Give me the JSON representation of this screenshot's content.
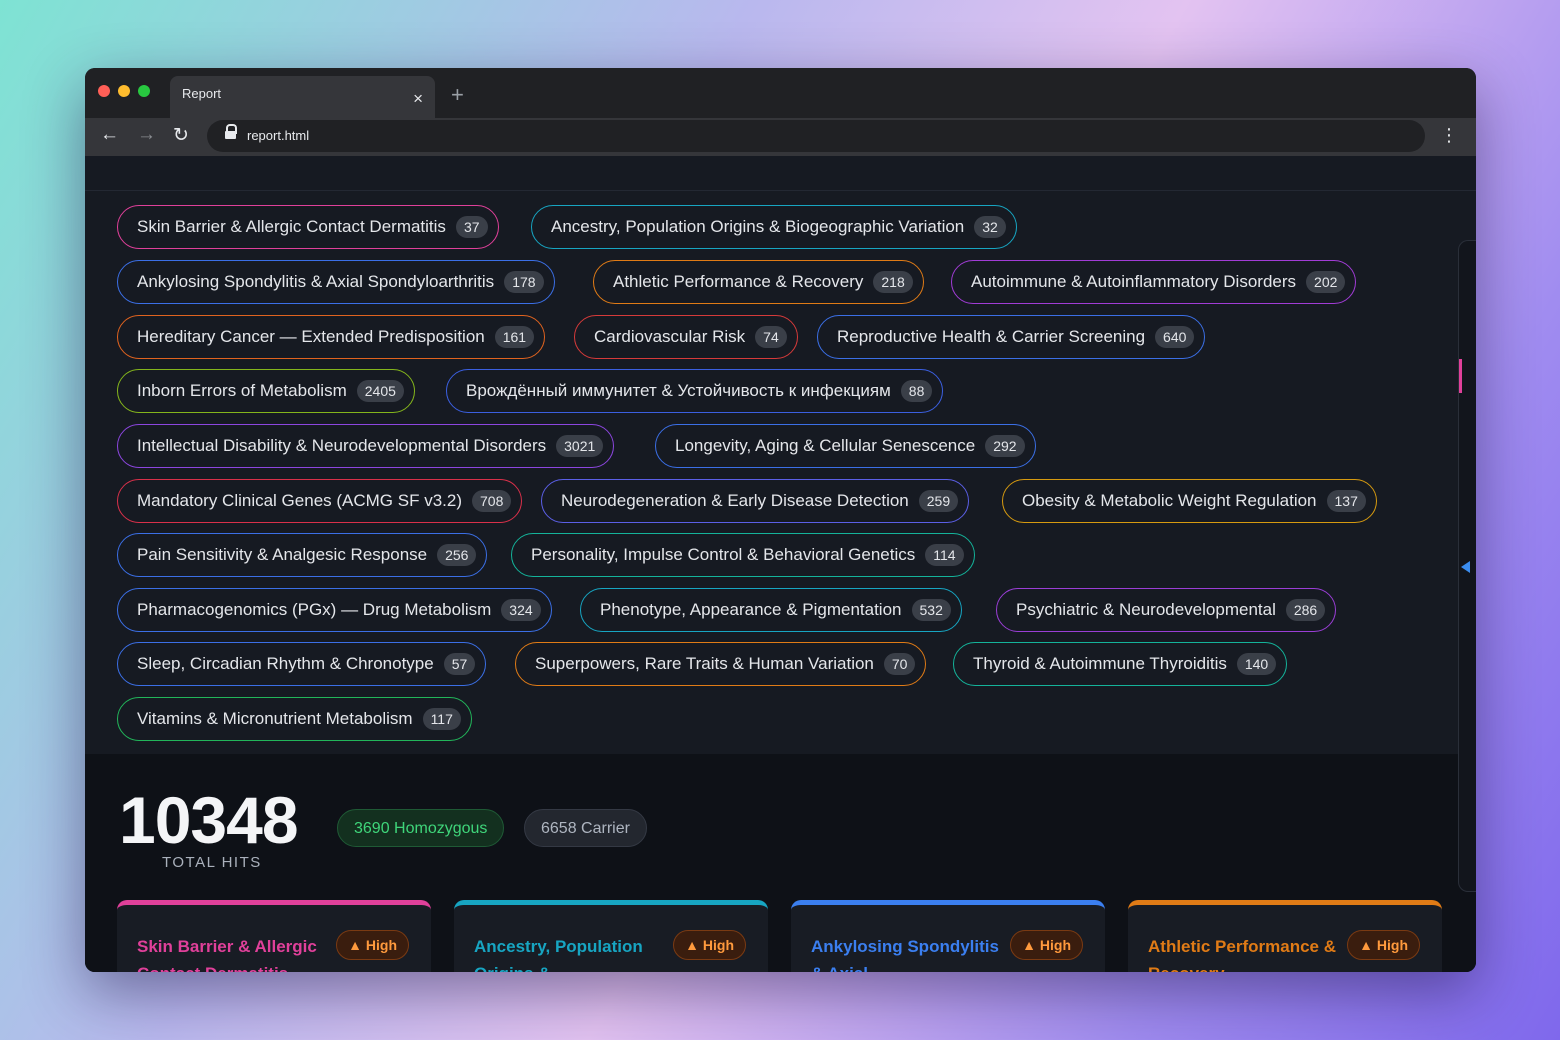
{
  "browser": {
    "tab_title": "Report",
    "tab_close": "×",
    "new_tab": "+",
    "url": "report.html",
    "back": "←",
    "forward": "→",
    "reload": "↻",
    "menu": "⋮"
  },
  "categories": [
    {
      "label": "Skin Barrier & Allergic Contact Dermatitis",
      "count": "37",
      "color": "#e0409a"
    },
    {
      "label": "Ancestry, Population Origins & Biogeographic Variation",
      "count": "32",
      "color": "#17a5c2"
    },
    {
      "label": "Ankylosing Spondylitis & Axial Spondyloarthritis",
      "count": "178",
      "color": "#3b6fe6"
    },
    {
      "label": "Athletic Performance & Recovery",
      "count": "218",
      "color": "#e07b16"
    },
    {
      "label": "Autoimmune & Autoinflammatory Disorders",
      "count": "202",
      "color": "#a13cd6"
    },
    {
      "label": "Hereditary Cancer — Extended Predisposition",
      "count": "161",
      "color": "#e0631f"
    },
    {
      "label": "Cardiovascular Risk",
      "count": "74",
      "color": "#d63a3a"
    },
    {
      "label": "Reproductive Health & Carrier Screening",
      "count": "640",
      "color": "#3b6fe6"
    },
    {
      "label": "Inborn Errors of Metabolism",
      "count": "2405",
      "color": "#84b51c"
    },
    {
      "label": "Врождённый иммунитет & Устойчивость к инфекциям",
      "count": "88",
      "color": "#3b5fe0"
    },
    {
      "label": "Intellectual Disability & Neurodevelopmental Disorders",
      "count": "3021",
      "color": "#8c46e0"
    },
    {
      "label": "Longevity, Aging & Cellular Senescence",
      "count": "292",
      "color": "#3b6fe6"
    },
    {
      "label": "Mandatory Clinical Genes (ACMG SF v3.2)",
      "count": "708",
      "color": "#d9304a"
    },
    {
      "label": "Neurodegeneration & Early Disease Detection",
      "count": "259",
      "color": "#5b5fe6"
    },
    {
      "label": "Obesity & Metabolic Weight Regulation",
      "count": "137",
      "color": "#d69a10"
    },
    {
      "label": "Pain Sensitivity & Analgesic Response",
      "count": "256",
      "color": "#3b6fe6"
    },
    {
      "label": "Personality, Impulse Control & Behavioral Genetics",
      "count": "114",
      "color": "#14b39a"
    },
    {
      "label": "Pharmacogenomics (PGx) — Drug Metabolism",
      "count": "324",
      "color": "#3b6fe6"
    },
    {
      "label": "Phenotype, Appearance & Pigmentation",
      "count": "532",
      "color": "#17a5c2"
    },
    {
      "label": "Psychiatric & Neurodevelopmental",
      "count": "286",
      "color": "#9a3ed6"
    },
    {
      "label": "Sleep, Circadian Rhythm & Chronotype",
      "count": "57",
      "color": "#3b6fe6"
    },
    {
      "label": "Superpowers, Rare Traits & Human Variation",
      "count": "70",
      "color": "#e07b16"
    },
    {
      "label": "Thyroid & Autoimmune Thyroiditis",
      "count": "140",
      "color": "#14b39a"
    },
    {
      "label": "Vitamins & Micronutrient Metabolism",
      "count": "117",
      "color": "#22b55a"
    }
  ],
  "summary": {
    "total": "10348",
    "total_label": "TOTAL HITS",
    "homozygous": "3690 Homozygous",
    "carrier": "6658 Carrier"
  },
  "cards": [
    {
      "title": "Skin Barrier & Allergic Contact Dermatitis",
      "badge": "▲ High",
      "color": "#e0409a"
    },
    {
      "title": "Ancestry, Population Origins & Biogeographic Variation",
      "badge": "▲ High",
      "color": "#17a5c2"
    },
    {
      "title": "Ankylosing Spondylitis & Axial Spondyloarthritis",
      "badge": "▲ High",
      "color": "#3b7ff0"
    },
    {
      "title": "Athletic Performance & Recovery",
      "badge": "▲ High",
      "color": "#e07b16"
    }
  ]
}
